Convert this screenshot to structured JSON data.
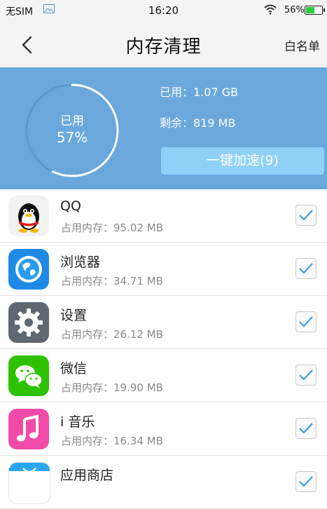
{
  "status_bar": {
    "carrier": "无SIM",
    "time": "16:20",
    "battery": "56%",
    "battery_level": 0.56
  },
  "nav": {
    "title": "内存清理",
    "whitelist_label": "白名单"
  },
  "memory": {
    "ring_label": "已用",
    "used_percent": "57%",
    "used_fraction": 0.57,
    "used_text": "已用：1.07 GB",
    "free_text": "剩余：819 MB",
    "boost_label": "一键加速(9)"
  },
  "apps": [
    {
      "name": "QQ",
      "memory": "占用内存：95.02 MB",
      "icon": "qq-penguin-icon",
      "checked": true
    },
    {
      "name": "浏览器",
      "memory": "占用内存：34.71 MB",
      "icon": "browser-globe-icon",
      "checked": true
    },
    {
      "name": "设置",
      "memory": "占用内存：26.12 MB",
      "icon": "settings-gear-icon",
      "checked": true
    },
    {
      "name": "微信",
      "memory": "占用内存：19.90 MB",
      "icon": "wechat-icon",
      "checked": true
    },
    {
      "name": "i 音乐",
      "memory": "占用内存：16.34 MB",
      "icon": "music-note-icon",
      "checked": true
    },
    {
      "name": "应用商店",
      "memory": "",
      "icon": "app-store-icon",
      "checked": true
    }
  ],
  "colors": {
    "panel": "#6aa8dc",
    "button": "#8fd1f6",
    "check": "#3a9fe0"
  }
}
